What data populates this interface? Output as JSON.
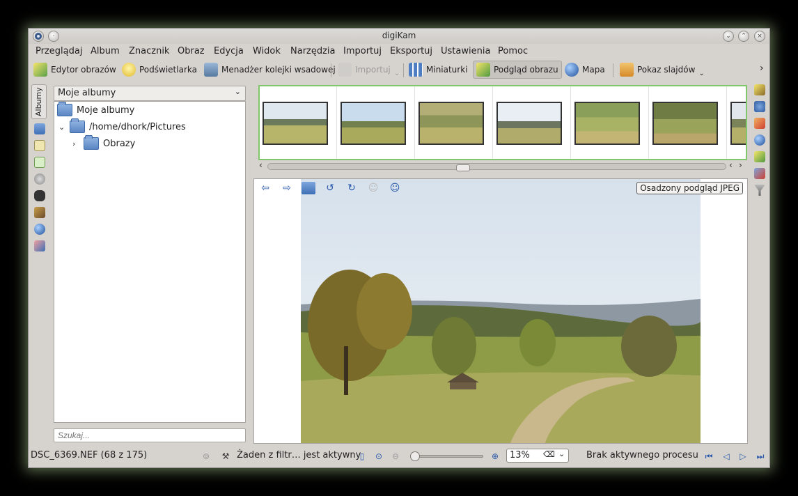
{
  "window": {
    "title": "digiKam"
  },
  "menu": [
    "Przeglądaj",
    "Album",
    "Znacznik",
    "Obraz",
    "Edycja",
    "Widok",
    "Narzędzia",
    "Importuj",
    "Eksportuj",
    "Ustawienia",
    "Pomoc"
  ],
  "toolbar": {
    "image_editor": "Edytor obrazów",
    "light_table": "Podświetlarka",
    "batch_queue": "Menadżer kolejki wsadowej",
    "import": "Importuj",
    "thumbnails": "Miniaturki",
    "preview": "Podgląd obrazu",
    "map": "Mapa",
    "slideshow": "Pokaz slajdów",
    "more": "›"
  },
  "left_tab": {
    "label": "Albumy"
  },
  "album_combo": {
    "value": "Moje albumy"
  },
  "tree": {
    "root": "Moje albumy",
    "collection": "/home/dhork/Pictures",
    "subalbum": "Obrazy"
  },
  "search": {
    "placeholder": "Szukaj..."
  },
  "preview": {
    "embedded_label": "Osadzony podgląd JPEG"
  },
  "status": {
    "file": "DSC_6369.NEF (68 z 175)",
    "filter": "Żaden z filtr… jest aktywny",
    "zoom": "13%",
    "process": "Brak aktywnego procesu"
  },
  "colors": {
    "accent_green": "#80c66a",
    "folder_blue": "#5a86c4",
    "window_bg": "#d6d3cf"
  }
}
